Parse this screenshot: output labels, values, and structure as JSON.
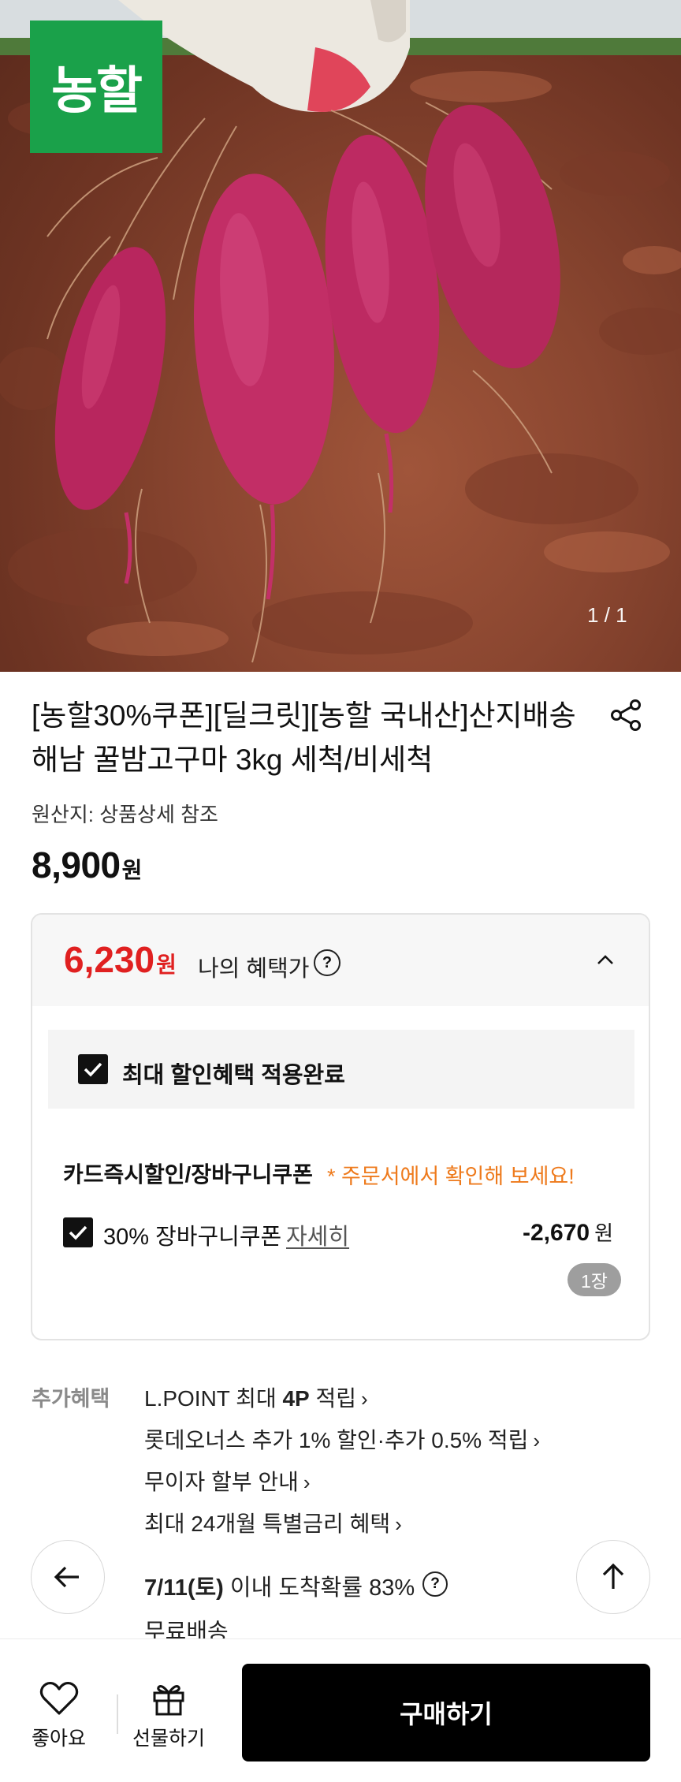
{
  "hero": {
    "brand_logo": "농할",
    "page_indicator": "1 / 1"
  },
  "product": {
    "title": "[농할30%쿠폰][딜크릿][농할 국내산]산지배송 해남 꿀밤고구마 3kg 세척/비세척",
    "origin": "원산지: 상품상세 참조",
    "price": "8,900",
    "currency": "원"
  },
  "benefit": {
    "price": "6,230",
    "currency": "원",
    "label": "나의 혜택가",
    "help": "?",
    "max_discount_label": "최대 할인혜택 적용완료",
    "card_title": "카드즉시할인/장바구니쿠폰",
    "card_note": "* 주문서에서 확인해 보세요!",
    "coupon_label": "30% 장바구니쿠폰",
    "coupon_detail": "자세히",
    "coupon_amount": "-2,670",
    "coupon_currency": "원",
    "coupon_count": "1장"
  },
  "extra": {
    "label": "추가혜택",
    "items": [
      {
        "pre": "L.POINT 최대 ",
        "bold": "4P",
        "post": " 적립"
      },
      {
        "pre": "롯데오너스 추가 1% 할인·추가 0.5% 적립",
        "bold": "",
        "post": ""
      },
      {
        "pre": "무이자 할부 안내",
        "bold": "",
        "post": ""
      },
      {
        "pre": "최대 24개월 특별금리 혜택",
        "bold": "",
        "post": ""
      }
    ],
    "chevron": "›"
  },
  "delivery": {
    "date": "7/11(토)",
    "text": " 이내 도착확률 83%",
    "help": "?",
    "shipping": "무료배송"
  },
  "bottom_bar": {
    "like_label": "좋아요",
    "gift_label": "선물하기",
    "buy_label": "구매하기"
  },
  "colors": {
    "benefit_price": "#e02020",
    "note": "#ee7a1c",
    "brand_green": "#1aa14a"
  }
}
